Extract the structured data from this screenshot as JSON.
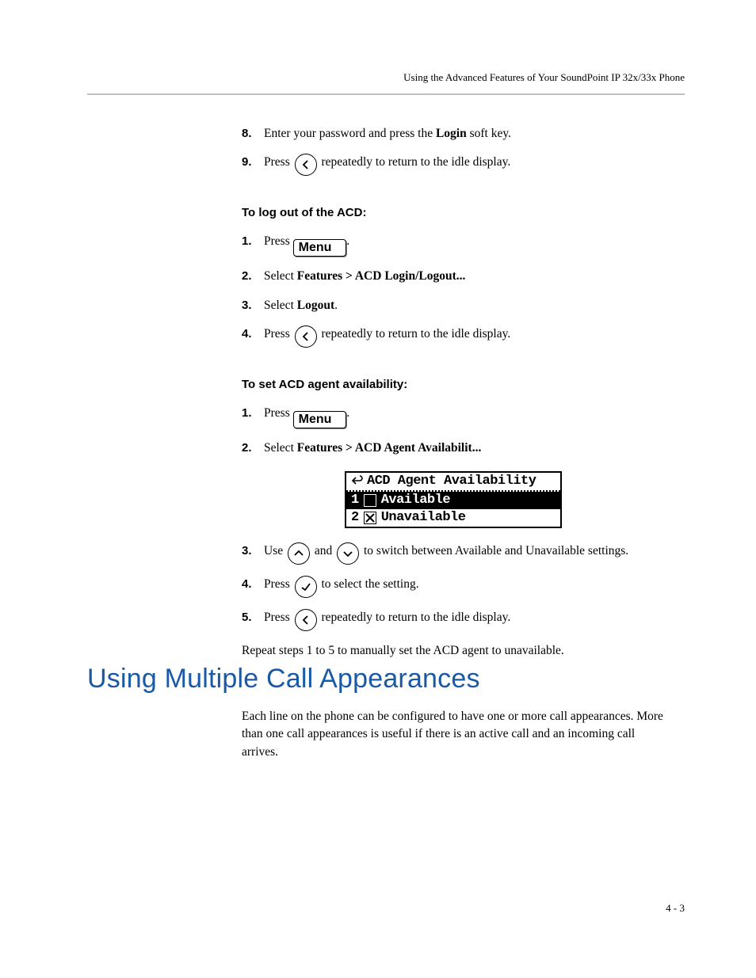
{
  "running_head": "Using the Advanced Features of Your SoundPoint IP 32x/33x Phone",
  "stepsA": {
    "8": {
      "pre": "Enter your password and press the ",
      "bold": "Login",
      "post": " soft key."
    },
    "9": {
      "pre": "Press ",
      "post": " repeatedly to return to the idle display."
    }
  },
  "subhead1": "To log out of the ACD:",
  "stepsB": {
    "1": {
      "pre": "Press ",
      "menu": "Menu",
      "post": "."
    },
    "2": {
      "pre": "Select ",
      "bold": "Features > ACD Login/Logout..."
    },
    "3": {
      "pre": "Select ",
      "bold": "Logout",
      "post": "."
    },
    "4": {
      "pre": "Press ",
      "post": " repeatedly to return to the idle display."
    }
  },
  "subhead2": "To set ACD agent availability:",
  "stepsC": {
    "1": {
      "pre": "Press ",
      "menu": "Menu",
      "post": "."
    },
    "2": {
      "pre": "Select ",
      "bold": "Features > ACD Agent Availabilit..."
    }
  },
  "lcd": {
    "title": "ACD Agent Availability",
    "opt1_num": "1",
    "opt1_label": "Available",
    "opt2_num": "2",
    "opt2_label": "Unavailable"
  },
  "stepsD": {
    "3": {
      "pre": "Use  ",
      "mid": "  and  ",
      "post": "  to switch between Available and Unavailable settings."
    },
    "4": {
      "pre": "Press ",
      "post": " to select the setting."
    },
    "5": {
      "pre": "Press ",
      "post": " repeatedly to return to the idle display."
    }
  },
  "repeat_note": "Repeat steps 1 to 5 to manually set the ACD agent to unavailable.",
  "h1": "Using Multiple Call Appearances",
  "body_para": "Each line on the phone can be configured to have one or more call appearances. More than one call appearances is useful if there is an active call and an incoming call arrives.",
  "page_number": "4 - 3"
}
